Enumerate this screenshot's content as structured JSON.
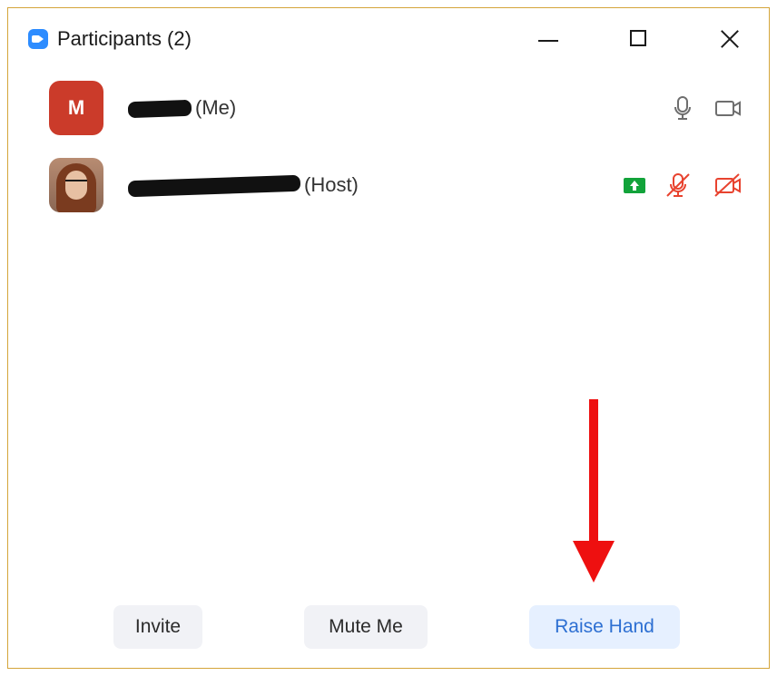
{
  "window": {
    "title": "Participants (2)",
    "icon": "zoom-video-icon",
    "controls": [
      "minimize-icon",
      "maximize-icon",
      "close-icon"
    ]
  },
  "participants": [
    {
      "avatar_letter": "M",
      "avatar_color": "#cb3b2a",
      "name_suffix": "(Me)",
      "name_redacted": true,
      "icons": [
        "microphone-icon",
        "video-camera-icon"
      ]
    },
    {
      "avatar": "profile-photo",
      "name_suffix": "(Host)",
      "name_redacted": true,
      "icons": [
        "screen-share-icon",
        "microphone-muted-icon",
        "video-camera-off-icon"
      ],
      "status_colors": {
        "share": "#12a33a",
        "muted": "#e8432f"
      }
    }
  ],
  "actions": {
    "invite_label": "Invite",
    "mute_label": "Mute Me",
    "raise_hand_label": "Raise Hand"
  },
  "annotation": {
    "type": "arrow",
    "color": "#ee1010",
    "points_to": "raise-hand-button"
  }
}
